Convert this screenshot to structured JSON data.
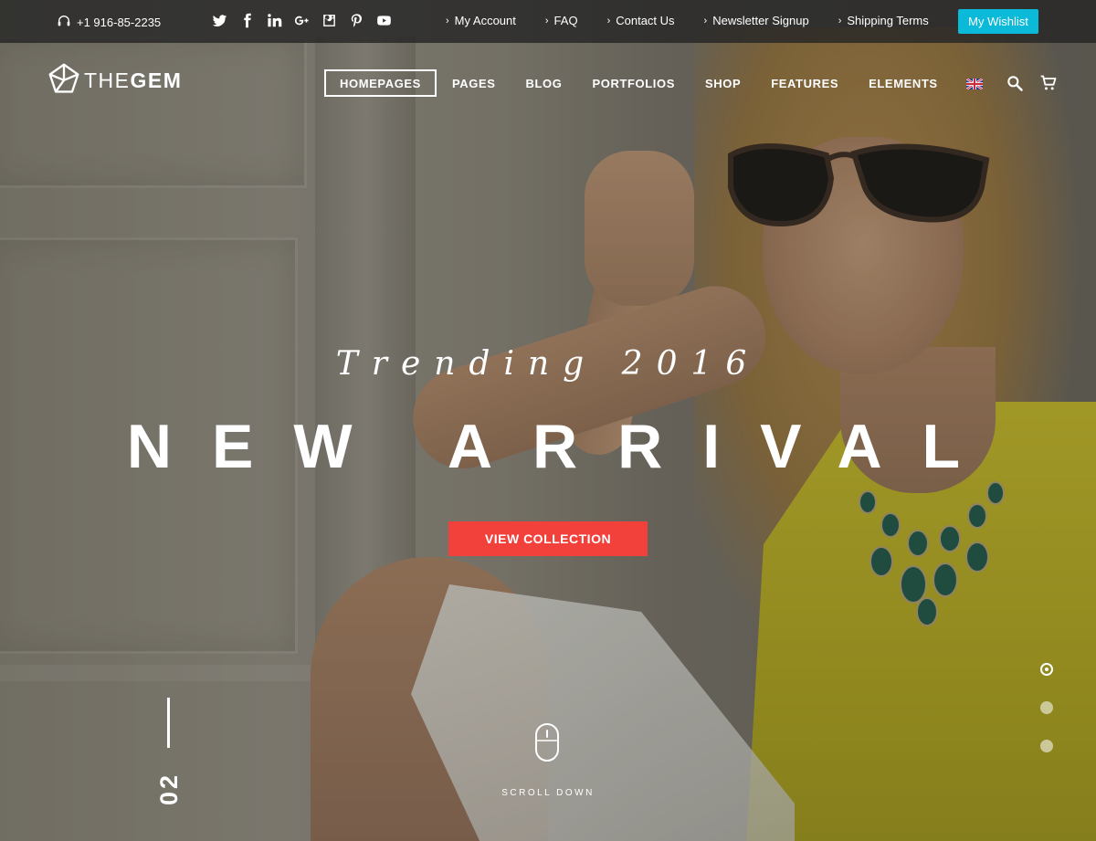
{
  "topbar": {
    "phone": "+1 916-85-2235",
    "social_icons": [
      "twitter-icon",
      "facebook-icon",
      "linkedin-icon",
      "googleplus-icon",
      "instagram-icon",
      "pinterest-icon",
      "youtube-icon"
    ],
    "links": [
      {
        "label": "My Account"
      },
      {
        "label": "FAQ"
      },
      {
        "label": "Contact Us"
      },
      {
        "label": "Newsletter Signup"
      },
      {
        "label": "Shipping Terms"
      }
    ],
    "wishlist_label": "My Wishlist",
    "wishlist_color": "#0bb9d8"
  },
  "brand": {
    "logo_light": "THE",
    "logo_bold": "GEM"
  },
  "nav": {
    "items": [
      {
        "label": "HOMEPAGES",
        "active": true
      },
      {
        "label": "PAGES"
      },
      {
        "label": "BLOG"
      },
      {
        "label": "PORTFOLIOS"
      },
      {
        "label": "SHOP"
      },
      {
        "label": "FEATURES"
      },
      {
        "label": "ELEMENTS"
      }
    ],
    "icons": [
      "uk-flag-icon",
      "search-icon",
      "cart-icon"
    ]
  },
  "hero": {
    "tagline": "Trending 2016",
    "headline": "NEW ARRIVAL",
    "cta_label": "VIEW COLLECTION",
    "cta_color": "#f2403b",
    "slide_number": "02",
    "scroll_label": "SCROLL DOWN",
    "slider": {
      "total": 3,
      "active_index": 0
    }
  }
}
